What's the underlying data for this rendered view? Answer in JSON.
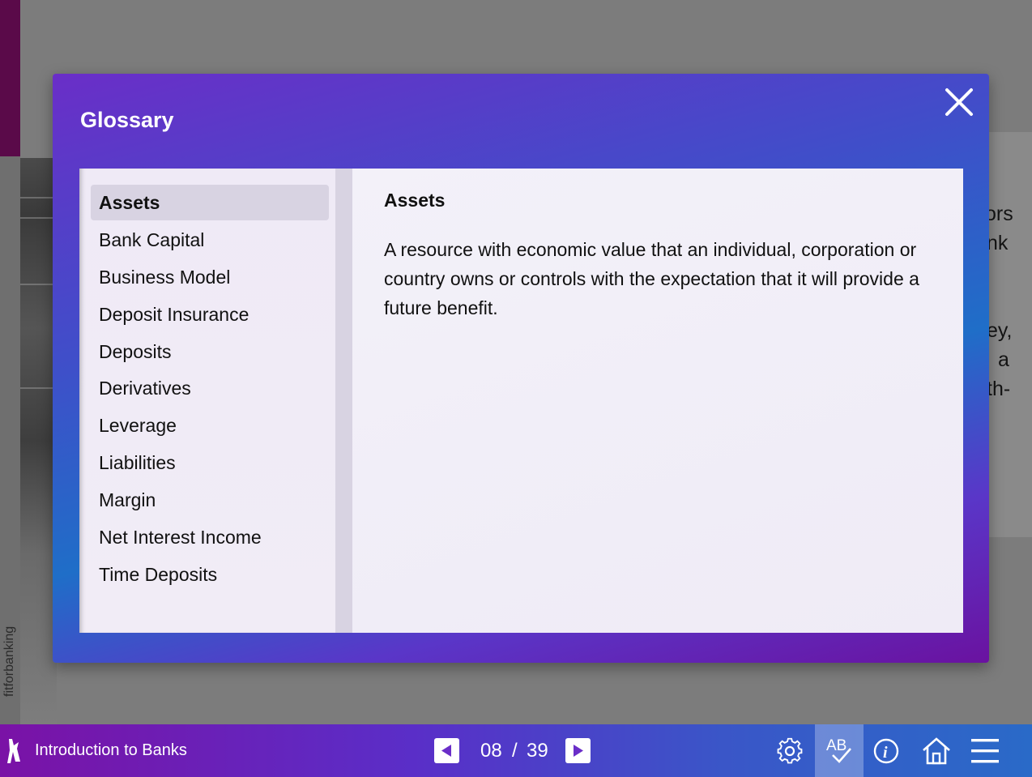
{
  "brand_vertical": "fitforbanking",
  "background_fragments": [
    "ors",
    "nk",
    "ey,",
    "a",
    "th-"
  ],
  "glossary": {
    "title": "Glossary",
    "terms": [
      "Assets",
      "Bank Capital",
      "Business Model",
      "Deposit Insurance",
      "Deposits",
      "Derivatives",
      "Leverage",
      "Liabilities",
      "Margin",
      "Net Interest Income",
      "Time Deposits"
    ],
    "selected_index": 0,
    "definition": {
      "term": "Assets",
      "text": "A resource with economic value that an individual, corporation or country owns or controls with the expectation that it will provide a future benefit."
    }
  },
  "bottom_bar": {
    "course_title": "Introduction to Banks",
    "page_current": "08",
    "page_separator": "/",
    "page_total": "39",
    "icons": {
      "logo": "brand-logo-icon",
      "prev": "prev-arrow-icon",
      "next": "next-arrow-icon",
      "settings": "gear-icon",
      "glossary": "glossary-ab-check-icon",
      "info": "info-icon",
      "home": "home-icon",
      "menu": "hamburger-menu-icon"
    }
  },
  "colors": {
    "modal_gradient_start": "#6a2ec8",
    "modal_gradient_mid": "#1f6ec8",
    "selected_term_bg": "#d8d3e2",
    "bottom_bar_start": "#7a12a6",
    "bottom_bar_end": "#2a6ac8"
  }
}
